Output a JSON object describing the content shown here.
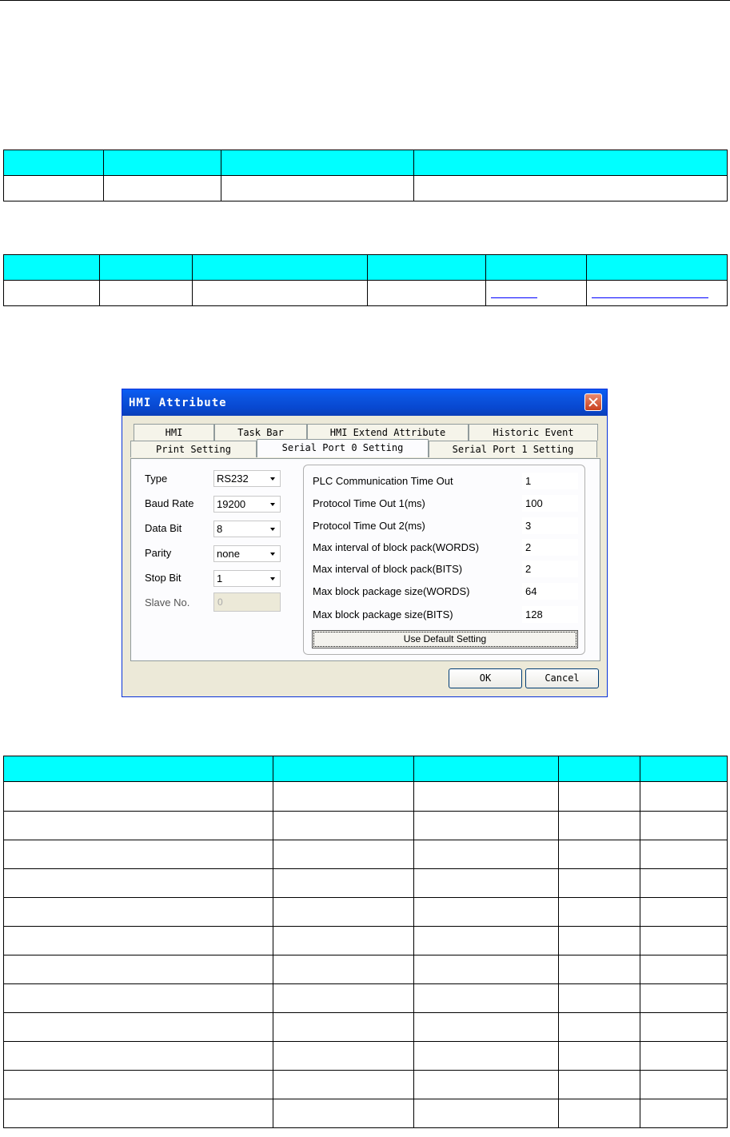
{
  "dialog": {
    "title": "HMI Attribute",
    "tabs_row1": [
      "HMI",
      "Task Bar",
      "HMI Extend Attribute",
      "Historic Event"
    ],
    "tabs_row2": [
      "Print Setting",
      "Serial Port 0 Setting",
      "Serial Port 1 Setting"
    ],
    "active_tab": "Serial Port 0 Setting",
    "fields": [
      {
        "label": "Type",
        "value": "RS232"
      },
      {
        "label": "Baud Rate",
        "value": "19200"
      },
      {
        "label": "Data Bit",
        "value": "8"
      },
      {
        "label": "Parity",
        "value": "none"
      },
      {
        "label": "Stop Bit",
        "value": "1"
      }
    ],
    "slave": {
      "label": "Slave No.",
      "value": "0"
    },
    "params": [
      {
        "label": "PLC Communication Time Out",
        "value": "1"
      },
      {
        "label": "Protocol Time Out 1(ms)",
        "value": "100"
      },
      {
        "label": "Protocol Time Out 2(ms)",
        "value": "3"
      },
      {
        "label": "Max interval of block pack(WORDS)",
        "value": "2"
      },
      {
        "label": "Max interval of block pack(BITS)",
        "value": "2"
      },
      {
        "label": "Max block package size(WORDS)",
        "value": "64"
      },
      {
        "label": "Max block package size(BITS)",
        "value": "128"
      }
    ],
    "default_button": "Use Default Setting",
    "ok_button": "OK",
    "cancel_button": "Cancel"
  },
  "colors": {
    "table_header": "#00ffff",
    "title_bar": "#0a5ef5",
    "dialog_bg": "#ece9d8"
  }
}
